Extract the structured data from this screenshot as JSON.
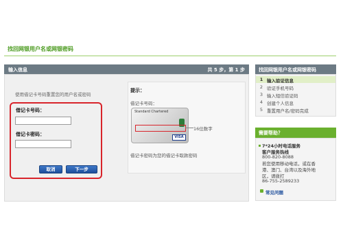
{
  "page": {
    "title": "找回网银用户名或网银密码"
  },
  "main": {
    "header": "输入信息",
    "step_indicator": "共 5 步，第 1 步",
    "intro": "使用借记卡号码重置您的用户名或密码",
    "form": {
      "card_number_label": "借记卡号码：",
      "card_number_value": "",
      "card_password_label": "借记卡密码：",
      "card_password_value": "",
      "cancel_label": "取消",
      "next_label": "下一步"
    },
    "hint": {
      "title": "提示：",
      "card_number_caption": "借记卡号码：",
      "card_bank_name": "Standard Chartered",
      "card_brand": "VISA",
      "digits_note": "16位数字",
      "password_note": "借记卡密码为您的借记卡取款密码"
    }
  },
  "sidebar": {
    "title": "找回网银用户名或网银密码",
    "steps": [
      {
        "num": "1",
        "label": "输入验证信息",
        "active": true
      },
      {
        "num": "2",
        "label": "验证手机号码",
        "active": false
      },
      {
        "num": "3",
        "label": "输入短信验证码",
        "active": false
      },
      {
        "num": "4",
        "label": "创建个人信息",
        "active": false
      },
      {
        "num": "5",
        "label": "重置用户名/密码完成",
        "active": false
      }
    ],
    "help": {
      "title": "需要帮助？",
      "line1": "7*24小时电话服务",
      "line2": "客户服务热线",
      "phone1": "800-820-8088",
      "line3": "若您使用移动电话，或在香",
      "line4": "港、澳门、台湾以及海外地",
      "line5": "区，请拨打",
      "phone2": "86-755-2589233",
      "faq": "常见问题"
    }
  },
  "colors": {
    "accent_green": "#4a9a1e",
    "header_gray": "#6c7a84",
    "highlight_red": "#d8232a",
    "button_blue": "#1f4f9c"
  }
}
